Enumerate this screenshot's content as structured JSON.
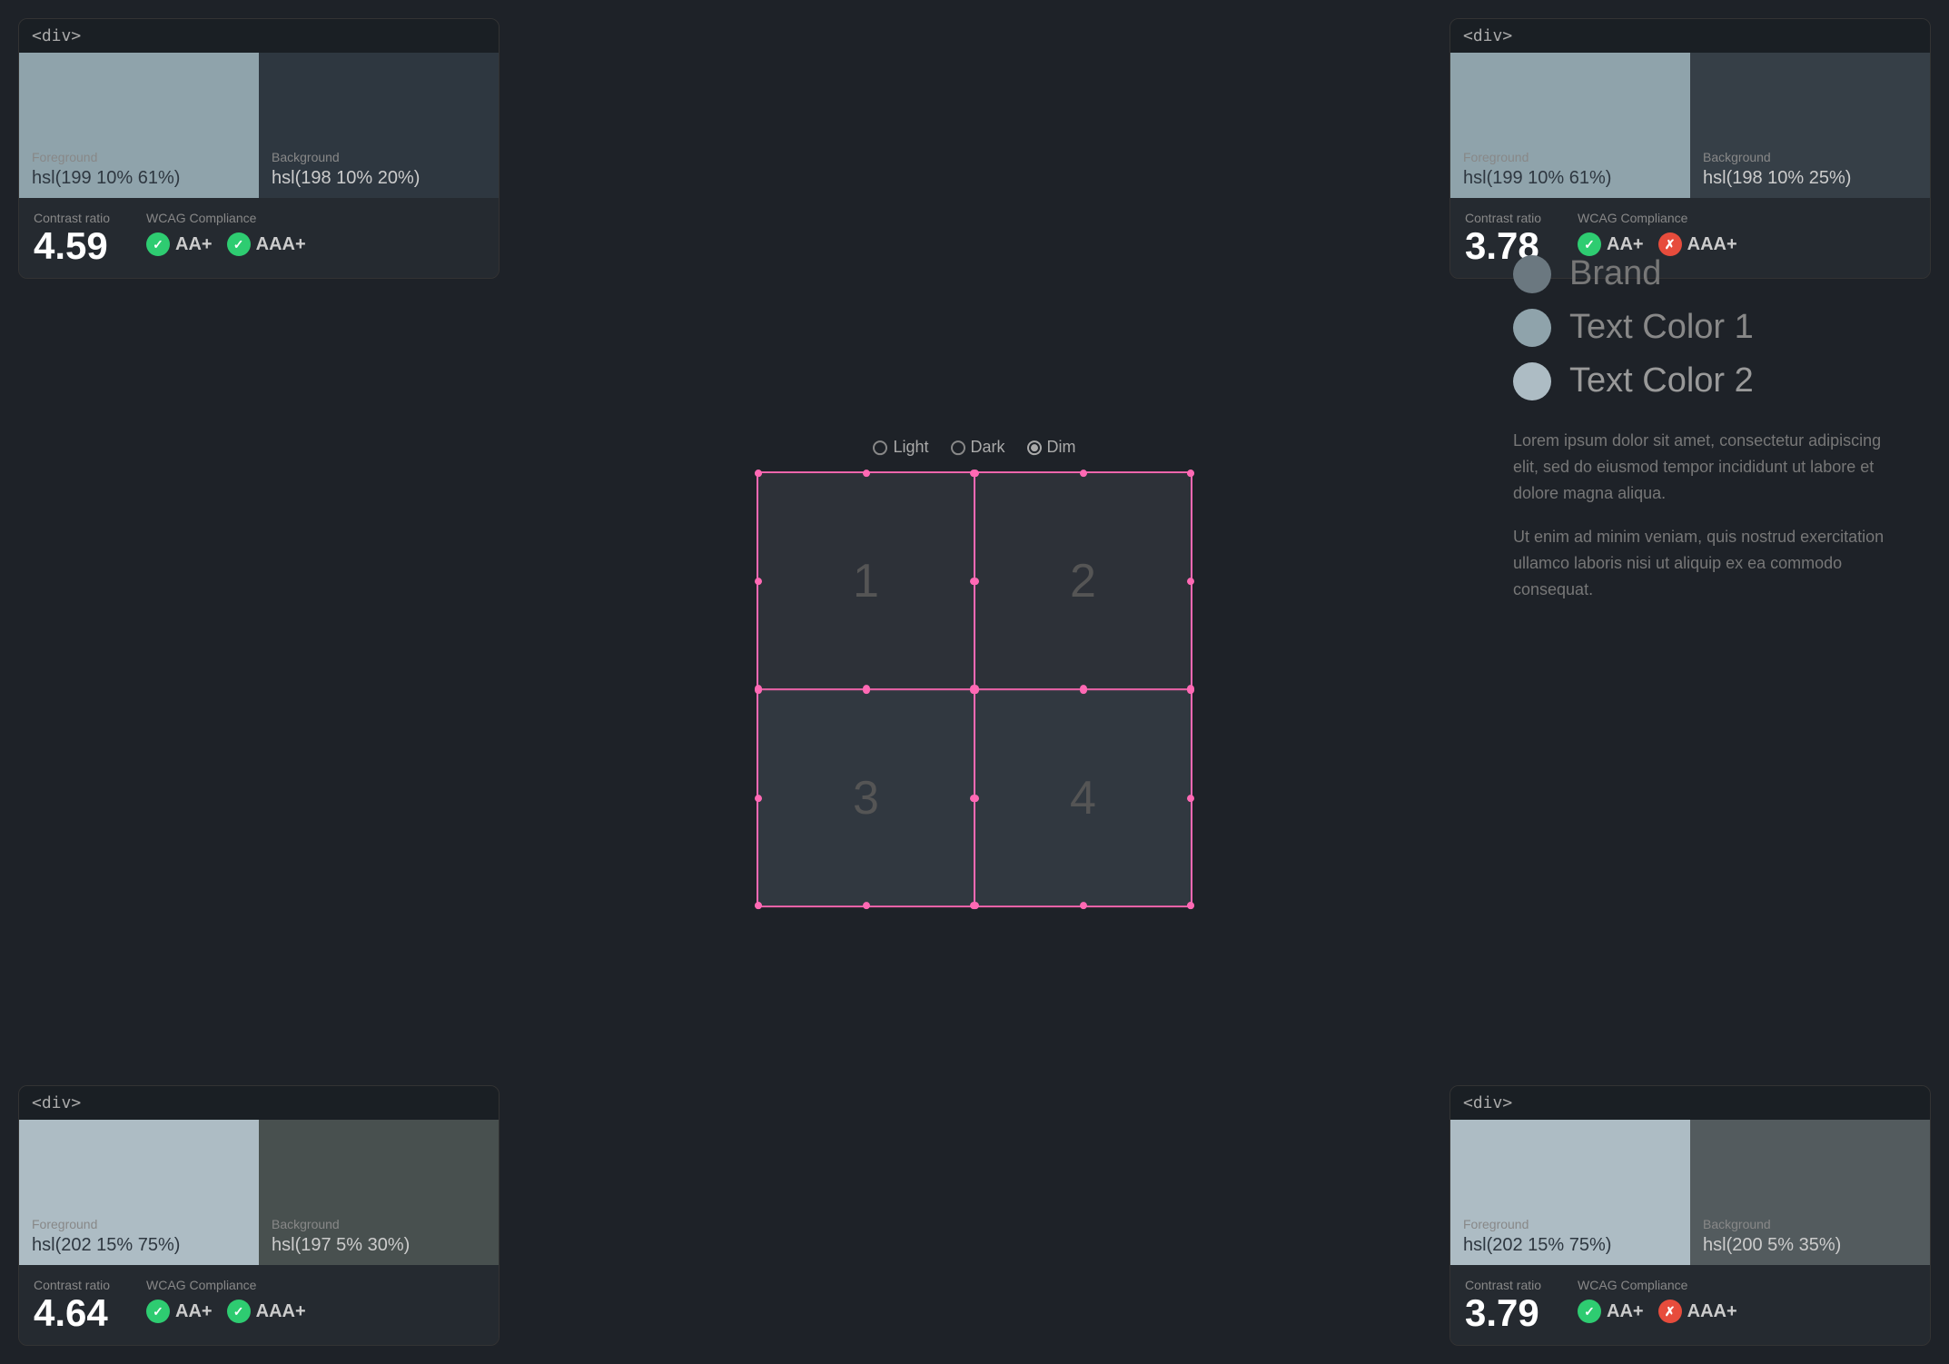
{
  "cards": {
    "top_left": {
      "tag": "<div>",
      "foreground_label": "Foreground",
      "foreground_value": "hsl(199 10% 61%)",
      "foreground_color": "#8fa3ab",
      "background_label": "Background",
      "background_value": "hsl(198 10% 20%)",
      "background_color": "#2e3740",
      "contrast_label": "Contrast ratio",
      "contrast_value": "4.59",
      "wcag_label": "WCAG Compliance",
      "aa_label": "AA+",
      "aaa_label": "AAA+",
      "aa_pass": true,
      "aaa_pass": true
    },
    "top_right": {
      "tag": "<div>",
      "foreground_label": "Foreground",
      "foreground_value": "hsl(199 10% 61%)",
      "foreground_color": "#8fa3ab",
      "background_label": "Background",
      "background_value": "hsl(198 10% 25%)",
      "background_color": "#363f47",
      "contrast_label": "Contrast ratio",
      "contrast_value": "3.78",
      "wcag_label": "WCAG Compliance",
      "aa_label": "AA+",
      "aaa_label": "AAA+",
      "aa_pass": true,
      "aaa_pass": false
    },
    "bottom_left": {
      "tag": "<div>",
      "foreground_label": "Foreground",
      "foreground_value": "hsl(202 15% 75%)",
      "foreground_color": "#adbcc4",
      "background_label": "Background",
      "background_value": "hsl(197 5% 30%)",
      "background_color": "#48504f",
      "contrast_label": "Contrast ratio",
      "contrast_value": "4.64",
      "wcag_label": "WCAG Compliance",
      "aa_label": "AA+",
      "aaa_label": "AAA+",
      "aa_pass": true,
      "aaa_pass": true
    },
    "bottom_right": {
      "tag": "<div>",
      "foreground_label": "Foreground",
      "foreground_value": "hsl(202 15% 75%)",
      "foreground_color": "#adbcc4",
      "background_label": "Background",
      "background_value": "hsl(200 5% 35%)",
      "background_color": "#535b5e",
      "contrast_label": "Contrast ratio",
      "contrast_value": "3.79",
      "wcag_label": "WCAG Compliance",
      "aa_label": "AA+",
      "aaa_label": "AAA+",
      "aa_pass": true,
      "aaa_pass": false
    }
  },
  "theme": {
    "options": [
      "Light",
      "Dark",
      "Dim"
    ],
    "selected": "Dim"
  },
  "grid": {
    "panels": [
      "1",
      "2",
      "3",
      "4"
    ]
  },
  "legend": {
    "items": [
      {
        "label": "Brand",
        "color": "#6b7880"
      },
      {
        "label": "Text Color 1",
        "color": "#8fa3ab"
      },
      {
        "label": "Text Color 2",
        "color": "#adbcc4"
      }
    ]
  },
  "lorem": {
    "p1": "Lorem ipsum dolor sit amet, consectetur adipiscing elit, sed do eiusmod tempor incididunt ut labore et dolore magna aliqua.",
    "p2": "Ut enim ad minim veniam, quis nostrud exercitation ullamco laboris nisi ut aliquip ex ea commodo consequat."
  }
}
